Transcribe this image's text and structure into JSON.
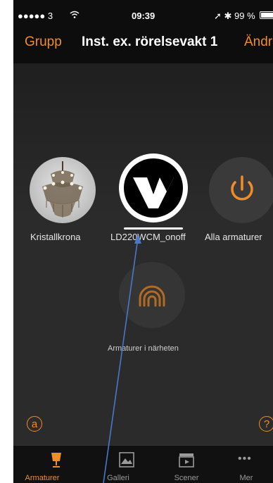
{
  "status_bar": {
    "signal": "●●●●● 3 ",
    "time": "09:39",
    "right": "➚ ✱ 99 %"
  },
  "nav": {
    "left": "Grupp",
    "title": "Inst. ex. rörelsevakt 1",
    "right": "Ändr"
  },
  "fixtures": [
    {
      "label": "Kristallkrona",
      "icon": "chandelier-icon"
    },
    {
      "label": "LD220WCM_onoff",
      "icon": "brand-v-logo-icon"
    },
    {
      "label": "Alla armaturer",
      "icon": "power-icon"
    }
  ],
  "nearby": {
    "label": "Armaturer i närheten",
    "icon": "signal-icon"
  },
  "corner_left": "a",
  "corner_right": "?",
  "tabs": [
    {
      "label": "Armaturer",
      "icon": "lamp-icon",
      "active": true
    },
    {
      "label": "Galleri",
      "icon": "gallery-icon",
      "active": false
    },
    {
      "label": "Scener",
      "icon": "clapper-icon",
      "active": false
    },
    {
      "label": "Mer",
      "icon": "more-icon",
      "active": false
    }
  ],
  "colors": {
    "accent": "#f28c28",
    "background": "#262626",
    "arrow": "#4a78c8"
  }
}
